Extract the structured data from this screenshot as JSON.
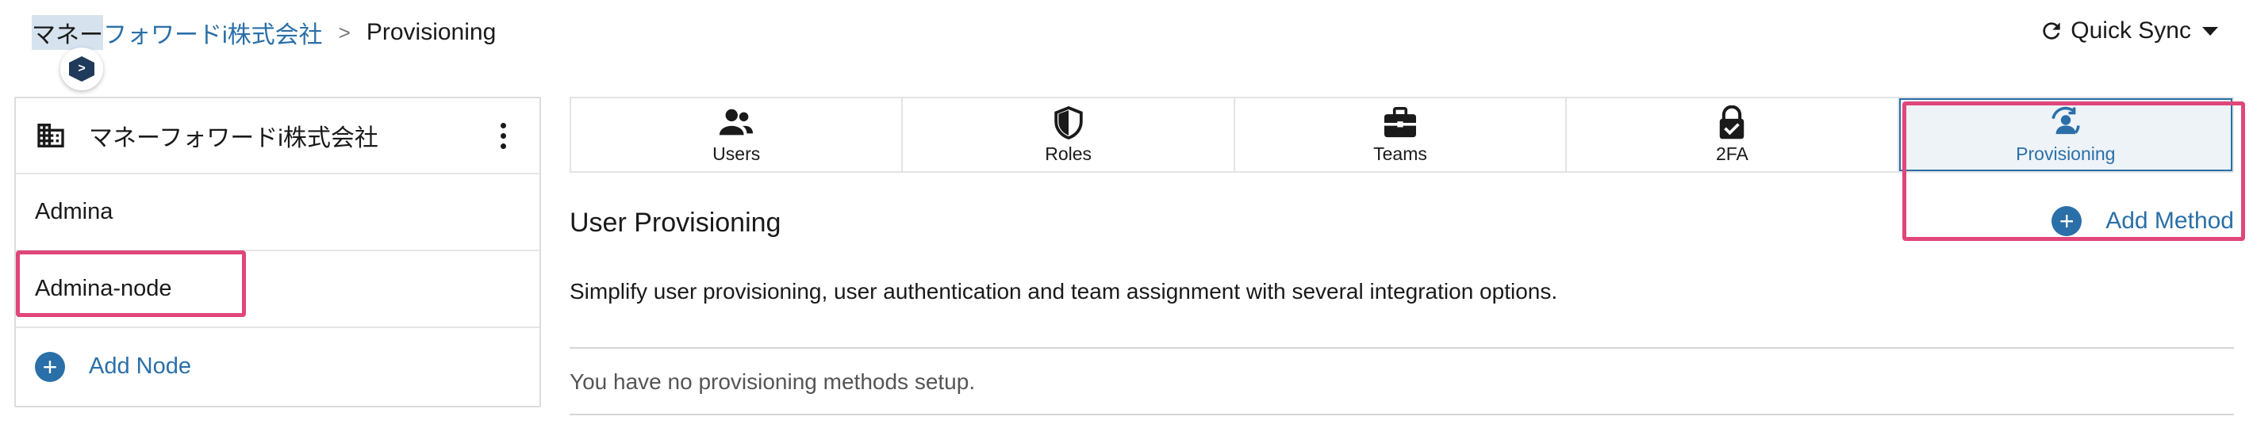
{
  "breadcrumb": {
    "org_highlight": "マネー",
    "org_rest": "フォワードi株式会社",
    "separator": ">",
    "current": "Provisioning"
  },
  "header": {
    "quick_sync_label": "Quick Sync"
  },
  "left_panel": {
    "org_name": "マネーフォワードi株式会社",
    "nodes": [
      "Admina",
      "Admina-node"
    ],
    "add_node_label": "Add Node"
  },
  "tabs": [
    {
      "label": "Users",
      "icon": "users-icon"
    },
    {
      "label": "Roles",
      "icon": "shield-icon"
    },
    {
      "label": "Teams",
      "icon": "briefcase-icon"
    },
    {
      "label": "2FA",
      "icon": "lock-check-icon"
    },
    {
      "label": "Provisioning",
      "icon": "user-sync-icon",
      "active": true
    }
  ],
  "main": {
    "title": "User Provisioning",
    "add_method_label": "Add Method",
    "description": "Simplify user provisioning, user authentication and team assignment with several integration options.",
    "empty_message": "You have no provisioning methods setup."
  },
  "colors": {
    "accent": "#2a6fa8",
    "highlight_box": "#e0467a"
  }
}
